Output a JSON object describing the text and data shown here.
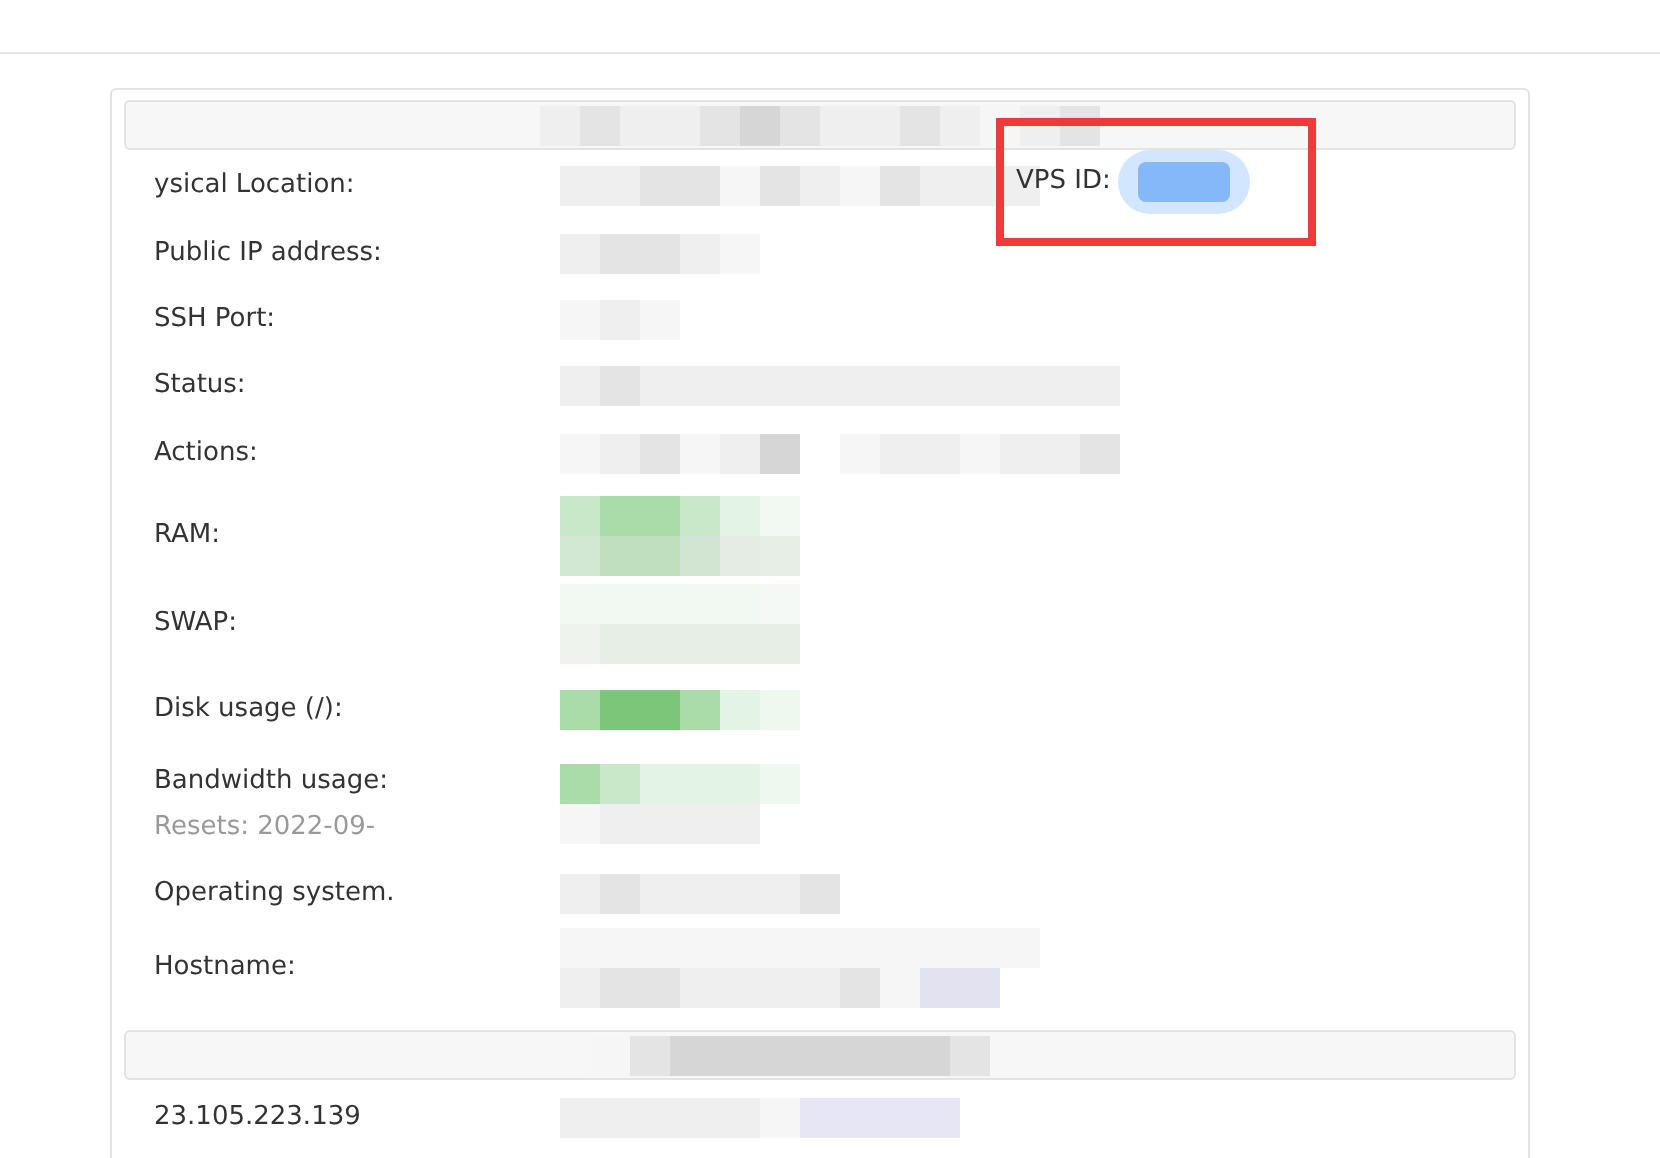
{
  "details": {
    "rows": [
      {
        "label": "ysical Location:"
      },
      {
        "label": "Public IP address:"
      },
      {
        "label": "SSH Port:"
      },
      {
        "label": "Status:"
      },
      {
        "label": "Actions:"
      },
      {
        "label": "RAM:"
      },
      {
        "label": "SWAP:"
      },
      {
        "label": "Disk usage (/):"
      },
      {
        "label": "Bandwidth usage:",
        "note": "Resets: 2022-09-"
      },
      {
        "label": "Operating system."
      },
      {
        "label": "Hostname:"
      }
    ],
    "vps_id_label": "VPS ID:"
  },
  "ip_section": {
    "address": "23.105.223.139"
  }
}
